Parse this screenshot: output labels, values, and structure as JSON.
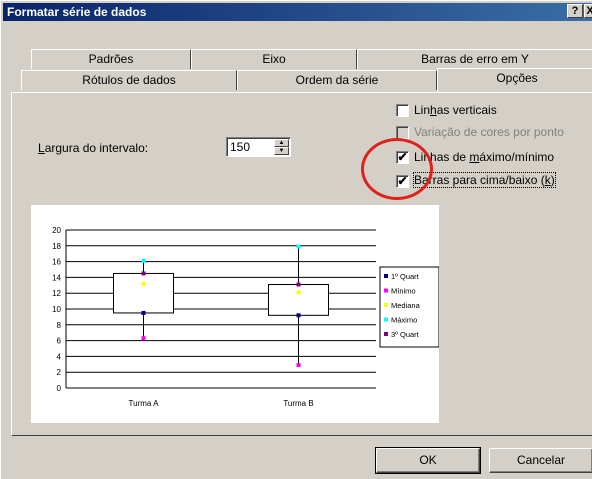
{
  "window": {
    "title": "Formatar série de dados",
    "help_label": "?",
    "close_label": "X"
  },
  "tabs_back": [
    "Padrões",
    "Eixo",
    "Barras de erro em Y"
  ],
  "tabs_front": [
    "Rótulos de dados",
    "Ordem da série",
    "Opções"
  ],
  "active_tab": "Opções",
  "options": {
    "linhas_verticais": {
      "pre": "Lin",
      "ul": "h",
      "post": "as verticais",
      "checked": false,
      "enabled": true
    },
    "variacao_cores": {
      "label": "Variação de cores por ponto",
      "checked": false,
      "enabled": false
    },
    "linhas_max_min": {
      "pre": "Linhas de ",
      "ul": "m",
      "post": "áximo/mínimo",
      "checked": true,
      "enabled": true
    },
    "barras_cima_baixo": {
      "pre": "Barras para cima/baixo (",
      "ul": "k",
      "post": ")",
      "checked": true,
      "enabled": true
    },
    "check_mark": "✔"
  },
  "gap_width": {
    "pre": "",
    "ul": "L",
    "post": "argura do intervalo:",
    "value": "150"
  },
  "chart_data": {
    "type": "stock",
    "categories": [
      "Turma A",
      "Turma B"
    ],
    "ylim": [
      0,
      20
    ],
    "yticks": [
      0,
      2,
      4,
      6,
      8,
      10,
      12,
      14,
      16,
      18,
      20
    ],
    "series": [
      {
        "name": "1º Quart",
        "values": [
          9.5,
          9.2
        ],
        "color": "#000080"
      },
      {
        "name": "Mínimo",
        "values": [
          6.3,
          2.9
        ],
        "color": "#ff00ff"
      },
      {
        "name": "Mediana",
        "values": [
          13.2,
          12.1
        ],
        "color": "#ffff00"
      },
      {
        "name": "Máximo",
        "values": [
          16.1,
          17.9
        ],
        "color": "#00ffff"
      },
      {
        "name": "3º Quart",
        "values": [
          14.5,
          13.1
        ],
        "color": "#800080"
      }
    ]
  },
  "buttons": {
    "ok": "OK",
    "cancel": "Cancelar"
  }
}
